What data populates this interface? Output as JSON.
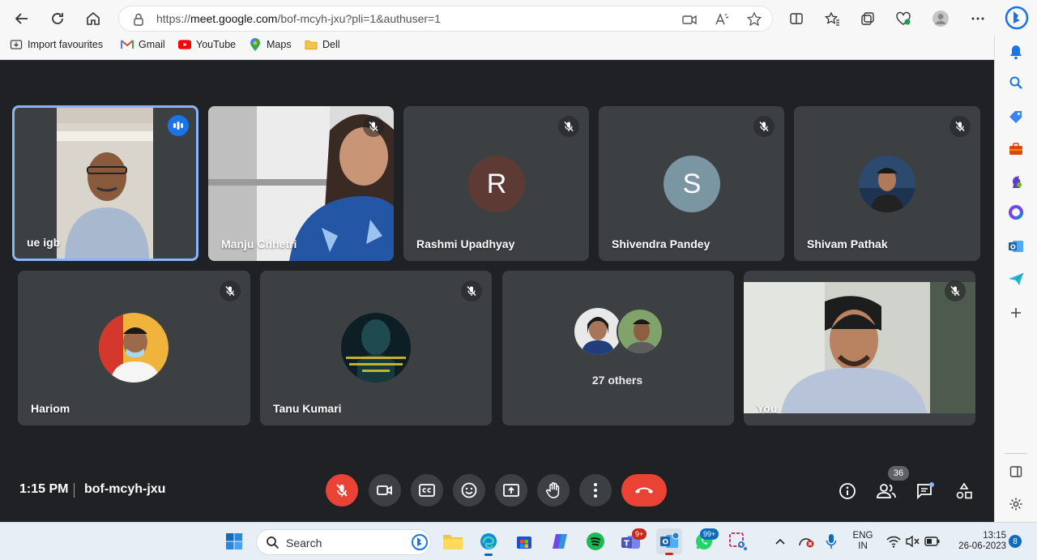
{
  "browser": {
    "url_prefix": "https://",
    "url_host": "meet.google.com",
    "url_path": "/bof-mcyh-jxu?pli=1&authuser=1",
    "bookmarks": [
      {
        "label": "Import favourites"
      },
      {
        "label": "Gmail"
      },
      {
        "label": "YouTube"
      },
      {
        "label": "Maps"
      },
      {
        "label": "Dell"
      }
    ]
  },
  "meeting": {
    "time": "1:15 PM",
    "code": "bof-mcyh-jxu",
    "participant_count": "36",
    "tiles": [
      {
        "name": "ue igb"
      },
      {
        "name": "Manju Chhetri"
      },
      {
        "name": "Rashmi Upadhyay",
        "initial": "R",
        "avatar_color": "#5d3a33"
      },
      {
        "name": "Shivendra Pandey",
        "initial": "S",
        "avatar_color": "#7a96a3"
      },
      {
        "name": "Shivam Pathak"
      },
      {
        "name": "Hariom"
      },
      {
        "name": "Tanu Kumari"
      },
      {
        "name": "27 others"
      },
      {
        "name": "You"
      }
    ]
  },
  "colors": {
    "meet_bg": "#202124",
    "tile_bg": "#3c4043",
    "hangup_red": "#ea4335",
    "active_blue": "#8ab4f8"
  },
  "taskbar": {
    "search_label": "Search",
    "teams_badge": "9+",
    "whatsapp_badge": "99+",
    "lang_line1": "ENG",
    "lang_line2": "IN",
    "clock_time": "13:15",
    "clock_date": "26-06-2023",
    "notification_count": "8"
  }
}
